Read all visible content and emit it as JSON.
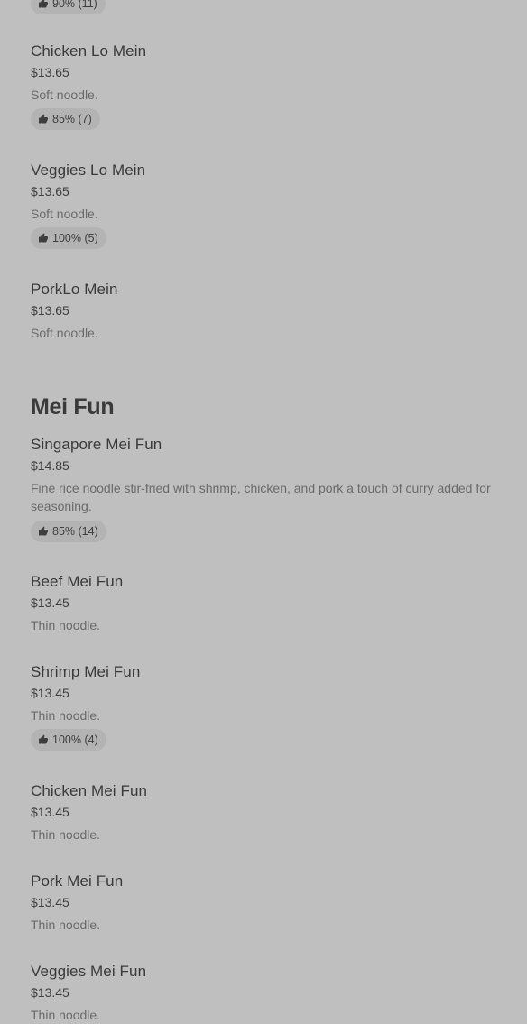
{
  "top_rating": {
    "percent": "90%",
    "count": "(11)"
  },
  "lo_mein": [
    {
      "name": "Chicken Lo Mein",
      "price": "$13.65",
      "desc": "Soft noodle.",
      "rating": {
        "percent": "85%",
        "count": "(7)"
      }
    },
    {
      "name": "Veggies Lo Mein",
      "price": "$13.65",
      "desc": "Soft noodle.",
      "rating": {
        "percent": "100%",
        "count": "(5)"
      }
    },
    {
      "name": "PorkLo Mein",
      "price": "$13.65",
      "desc": "Soft noodle."
    }
  ],
  "mei_fun_section": {
    "title": "Mei Fun",
    "items": [
      {
        "name": "Singapore Mei Fun",
        "price": "$14.85",
        "desc": "Fine rice noodle stir-fried with shrimp, chicken, and pork a touch of curry added for seasoning.",
        "rating": {
          "percent": "85%",
          "count": "(14)"
        }
      },
      {
        "name": "Beef Mei Fun",
        "price": "$13.45",
        "desc": "Thin noodle."
      },
      {
        "name": "Shrimp Mei Fun",
        "price": "$13.45",
        "desc": "Thin noodle.",
        "rating": {
          "percent": "100%",
          "count": "(4)"
        }
      },
      {
        "name": "Chicken Mei Fun",
        "price": "$13.45",
        "desc": "Thin noodle."
      },
      {
        "name": "Pork Mei Fun",
        "price": "$13.45",
        "desc": "Thin noodle."
      },
      {
        "name": "Veggies Mei Fun",
        "price": "$13.45",
        "desc": "Thin noodle."
      }
    ]
  },
  "icons": {
    "rating": "thumbs-up-icon"
  }
}
